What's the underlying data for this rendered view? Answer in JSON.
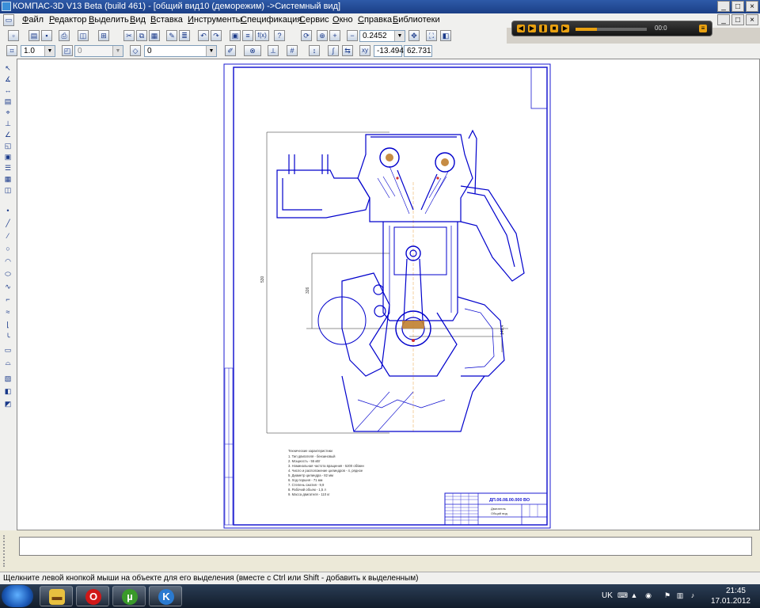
{
  "window": {
    "title": "КОМПАС-3D V13 Beta (build 461) - [общий вид10  (деморежим) ->Системный вид]",
    "controls": [
      "_",
      "□",
      "×"
    ]
  },
  "menu": [
    "Файл",
    "Редактор",
    "Выделить",
    "Вид",
    "Вставка",
    "Инструменты",
    "Спецификация",
    "Сервис",
    "Окно",
    "Справка",
    "Библиотеки"
  ],
  "toolbar": {
    "zoom_value": "0.2452",
    "fx_label": "f(x)"
  },
  "toolbar2": {
    "scale_value": "1.0",
    "layer_value": "0",
    "style_value": "0",
    "coord_x": "-13.494",
    "coord_y": "62.731"
  },
  "player": {
    "progress": 0.3,
    "time_label": "00:0"
  },
  "drawing": {
    "stamp_code": "ДП.06.08.00.000 ВО",
    "title_main": "Двигатель",
    "subtitle": "Общий вид",
    "tech_header": "Технические характеристики",
    "tech_lines": [
      "1. Тип двигателя - бензиновый",
      "2. Мощность - 55 кВт",
      "3. Номинальная частота вращения - 5200 об/мин",
      "4. Число и расположение цилиндров - 4, рядное",
      "5. Диаметр цилиндра - 82 мм",
      "6. Ход поршня - 71 мм",
      "7. Степень сжатия - 9,9",
      "8. Рабочий объем - 1,5 л",
      "9. Масса двигателя - 110 кг"
    ],
    "dim_height": "530",
    "dim_left": "326",
    "dim_right": "141,4"
  },
  "status": {
    "hint": "Щелкните левой кнопкой мыши на объекте для его выделения (вместе с Ctrl или Shift - добавить к выделенным)"
  },
  "taskbar": {
    "language": "UK",
    "time": "21:45",
    "date": "17.01.2012",
    "apps": [
      "explorer",
      "opera",
      "utorrent",
      "kompas"
    ]
  }
}
